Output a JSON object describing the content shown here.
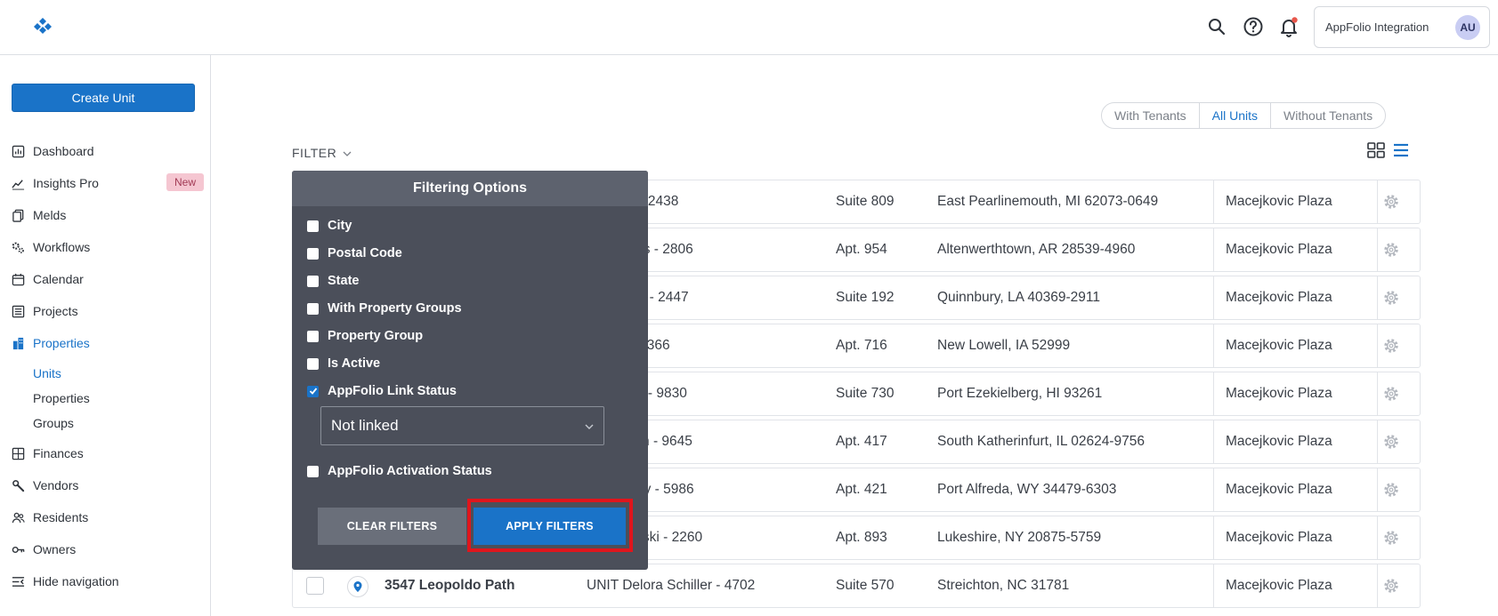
{
  "header": {
    "account_name": "AppFolio Integration",
    "avatar_initials": "AU",
    "notification_dot_color": "#e8574b",
    "brand_color": "#1a73c8"
  },
  "sidebar": {
    "create_label": "Create Unit",
    "items": [
      {
        "label": "Dashboard",
        "icon": "chart-icon"
      },
      {
        "label": "Insights Pro",
        "icon": "trend-icon",
        "badge": "New"
      },
      {
        "label": "Melds",
        "icon": "copy-icon"
      },
      {
        "label": "Workflows",
        "icon": "gears-icon"
      },
      {
        "label": "Calendar",
        "icon": "calendar-icon"
      },
      {
        "label": "Projects",
        "icon": "list-icon"
      },
      {
        "label": "Properties",
        "icon": "building-icon"
      },
      {
        "label": "Finances",
        "icon": "calculator-icon"
      },
      {
        "label": "Vendors",
        "icon": "wrench-icon"
      },
      {
        "label": "Residents",
        "icon": "people-icon"
      },
      {
        "label": "Owners",
        "icon": "key-icon"
      },
      {
        "label": "Hide navigation",
        "icon": "collapse-icon"
      }
    ],
    "sub_items": [
      "Units",
      "Properties",
      "Groups"
    ]
  },
  "main": {
    "segments": [
      "With Tenants",
      "All Units",
      "Without Tenants"
    ],
    "selected_segment": "All Units",
    "filter_label": "FILTER",
    "rows": [
      {
        "unit": "rick Von - 2438",
        "suite": "Suite 809",
        "address": "East Pearlinemouth, MI 62073-0649",
        "property": "Macejkovic Plaza"
      },
      {
        "unit": "da Grimes - 2806",
        "suite": "Apt. 954",
        "address": "Altenwerthtown, AR 28539-4960",
        "property": "Macejkovic Plaza"
      },
      {
        "unit": "Gorczany - 2447",
        "suite": "Suite 192",
        "address": "Quinnbury, LA 40369-2911",
        "property": "Macejkovic Plaza"
      },
      {
        "unit": "Pfeffer - 7366",
        "suite": "Apt. 716",
        "address": "New Lowell, IA 52999",
        "property": "Macejkovic Plaza"
      },
      {
        "unit": "ia Dooley - 9830",
        "suite": "Suite 730",
        "address": "Port Ezekielberg, HI 93261",
        "property": "Macejkovic Plaza"
      },
      {
        "unit": "sha Braun - 9645",
        "suite": "Apt. 417",
        "address": "South Katherinfurt, IL 02624-9756",
        "property": "Macejkovic Plaza"
      },
      {
        "unit": "rilyn Haley - 5986",
        "suite": "Apt. 421",
        "address": "Port Alfreda, WY 34479-6303",
        "property": "Macejkovic Plaza"
      },
      {
        "unit": "mer Osinski - 2260",
        "suite": "Apt. 893",
        "address": "Lukeshire, NY 20875-5759",
        "property": "Macejkovic Plaza"
      },
      {
        "street": "3547 Leopoldo Path",
        "unit": "UNIT Delora Schiller - 4702",
        "suite": "Suite 570",
        "address": "Streichton, NC 31781",
        "property": "Macejkovic Plaza"
      }
    ]
  },
  "filter_panel": {
    "title": "Filtering Options",
    "options": [
      {
        "label": "City",
        "checked": false
      },
      {
        "label": "Postal Code",
        "checked": false
      },
      {
        "label": "State",
        "checked": false
      },
      {
        "label": "With Property Groups",
        "checked": false
      },
      {
        "label": "Property Group",
        "checked": false
      },
      {
        "label": "Is Active",
        "checked": false
      },
      {
        "label": "AppFolio Link Status",
        "checked": true
      },
      {
        "label": "AppFolio Activation Status",
        "checked": false
      }
    ],
    "link_status_value": "Not linked",
    "clear_label": "CLEAR FILTERS",
    "apply_label": "APPLY FILTERS",
    "highlight_color": "#e0151c"
  }
}
